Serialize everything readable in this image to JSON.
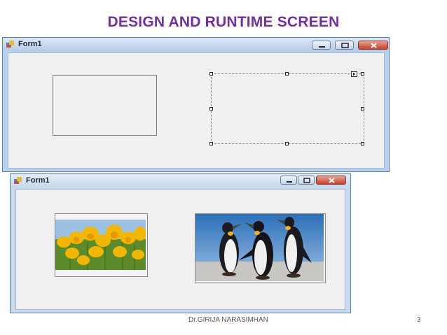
{
  "slide": {
    "title": "DESIGN AND RUNTIME SCREEN",
    "footer": "Dr.GIRIJA NARASIMHAN",
    "page_number": "3"
  },
  "design_window": {
    "title": "Form1",
    "icons": [
      "form-icon",
      "minimize-icon",
      "maximize-icon",
      "close-icon"
    ],
    "controls": [
      "picturebox-1",
      "picturebox-2-selected"
    ]
  },
  "runtime_window": {
    "title": "Form1",
    "icons": [
      "form-icon",
      "minimize-icon",
      "maximize-icon",
      "close-icon"
    ],
    "images": [
      {
        "name": "tulips-image",
        "subject": "yellow tulips"
      },
      {
        "name": "penguins-image",
        "subject": "penguins"
      }
    ]
  },
  "colors": {
    "title": "#7030a0",
    "window_border": "#b9d1ea",
    "client_bg": "#f0f0f0",
    "close_button": "#c4432d"
  }
}
